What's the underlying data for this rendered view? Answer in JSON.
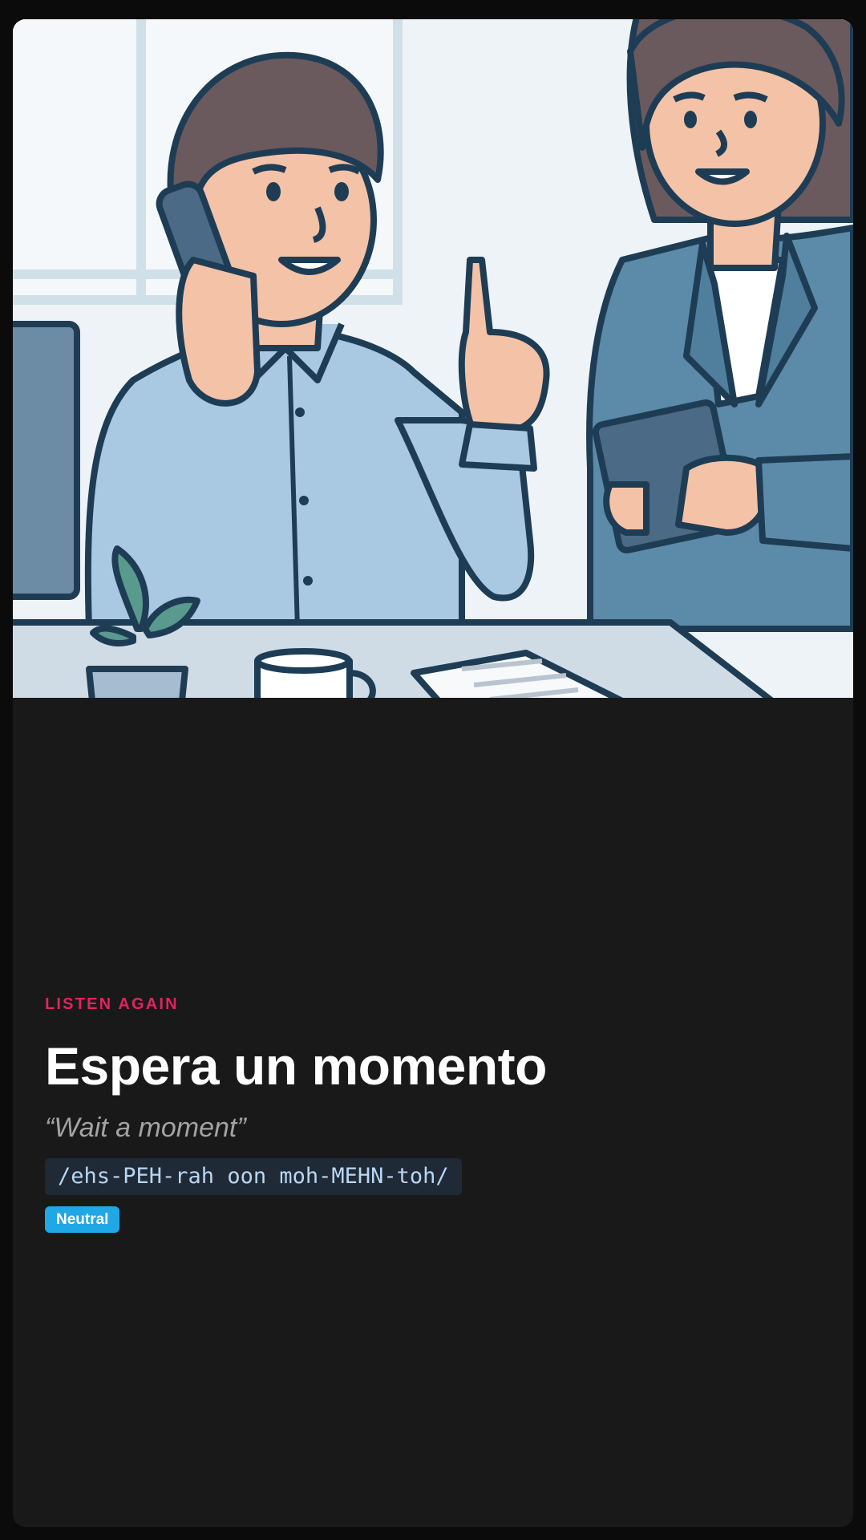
{
  "card": {
    "kicker": "LISTEN AGAIN",
    "phrase": "Espera un momento",
    "translation": "“Wait a moment”",
    "pronunciation": "/ehs-PEH-rah oon moh-MEHN-toh/",
    "register_badge": "Neutral"
  },
  "illustration": {
    "description_icon": "office-scene-illustration"
  },
  "colors": {
    "accent": "#e0245e",
    "badge": "#1fa7e6",
    "background": "#191919"
  }
}
